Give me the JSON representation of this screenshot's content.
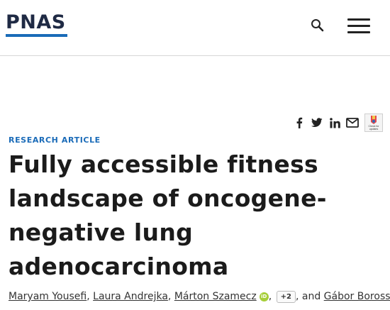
{
  "header": {
    "logo_text": "PNAS",
    "logo_color": "#1f2a44",
    "logo_accent": "#1a6bb8",
    "search_icon": "search-icon",
    "menu_icon": "hamburger-menu-icon"
  },
  "share": {
    "icons": [
      "facebook-icon",
      "twitter-icon",
      "linkedin-icon",
      "email-icon"
    ],
    "crossmark_label": "Check for updates"
  },
  "article": {
    "type": "RESEARCH ARTICLE",
    "title": "Fully accessible fitness landscape of oncogene-negative lung adenocarcinoma",
    "authors": [
      {
        "name": "Maryam Yousefi",
        "sep": ", "
      },
      {
        "name": "Laura Andrejka",
        "sep": ", "
      },
      {
        "name": "Márton Szamecz",
        "sep": ""
      }
    ],
    "orcid_label": "iD",
    "after_orcid": ", ",
    "more_authors": "+2",
    "and_text": ", and ",
    "last_author": "Gábor Boross"
  }
}
